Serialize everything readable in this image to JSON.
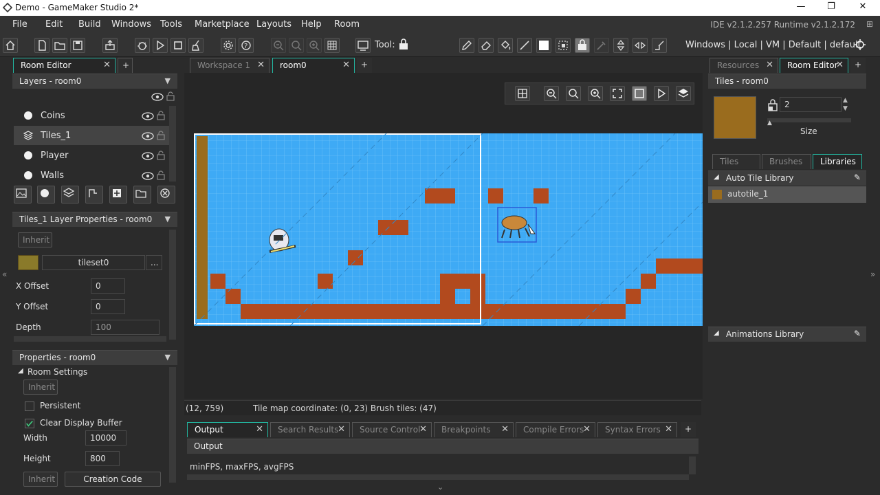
{
  "window": {
    "title": "Demo - GameMaker Studio 2*",
    "minimize": "—",
    "maximize": "❐",
    "close": "✕"
  },
  "menu": [
    "File",
    "Edit",
    "Build",
    "Windows",
    "Tools",
    "Marketplace",
    "Layouts",
    "Help",
    "Room"
  ],
  "ide_version": "IDE v2.1.2.257 Runtime v2.1.2.172",
  "toolbar": {
    "tool_label": "Tool:",
    "targets": "Windows | Local | VM | Default | default"
  },
  "left": {
    "tab": "Room Editor",
    "layers_header": "Layers - room0",
    "layers": [
      "Coins",
      "Tiles_1",
      "Player",
      "Walls"
    ],
    "props_header": "Tiles_1 Layer Properties - room0",
    "inherit": "Inherit",
    "tileset": "tileset0",
    "tileset_more": "...",
    "x_offset_label": "X Offset",
    "x_offset": "0",
    "y_offset_label": "Y Offset",
    "y_offset": "0",
    "depth_label": "Depth",
    "depth": "100",
    "room_props_header": "Properties - room0",
    "room_settings": "Room Settings",
    "inherit2": "Inherit",
    "persistent": "Persistent",
    "clear_display": "Clear Display Buffer",
    "width_label": "Width",
    "width": "10000",
    "height_label": "Height",
    "height": "800",
    "inherit3": "Inherit",
    "creation_code": "Creation Code"
  },
  "center": {
    "tabs": [
      "Workspace 1",
      "room0"
    ],
    "status_coord": "(12, 759)",
    "status_tile": "Tile map coordinate: (0, 23) Brush tiles: (47)",
    "output_tabs": [
      "Output",
      "Search Results",
      "Source Control",
      "Breakpoints",
      "Compile Errors",
      "Syntax Errors"
    ],
    "output_title": "Output",
    "output_text": "minFPS, maxFPS, avgFPS"
  },
  "right": {
    "tabs": [
      "Resources",
      "Room Editor"
    ],
    "header": "Tiles - room0",
    "size_value": "2",
    "size_label": "Size",
    "subtabs": [
      "Tiles",
      "Brushes",
      "Libraries"
    ],
    "auto_tile_lib": "Auto Tile Library",
    "autotile_item": "autotile_1",
    "anim_lib": "Animations Library"
  },
  "colors": {
    "accent": "#23b5a0",
    "sky": "#3eaaf5",
    "brick": "#b24a1e",
    "swatch": "#9a6c1e"
  }
}
